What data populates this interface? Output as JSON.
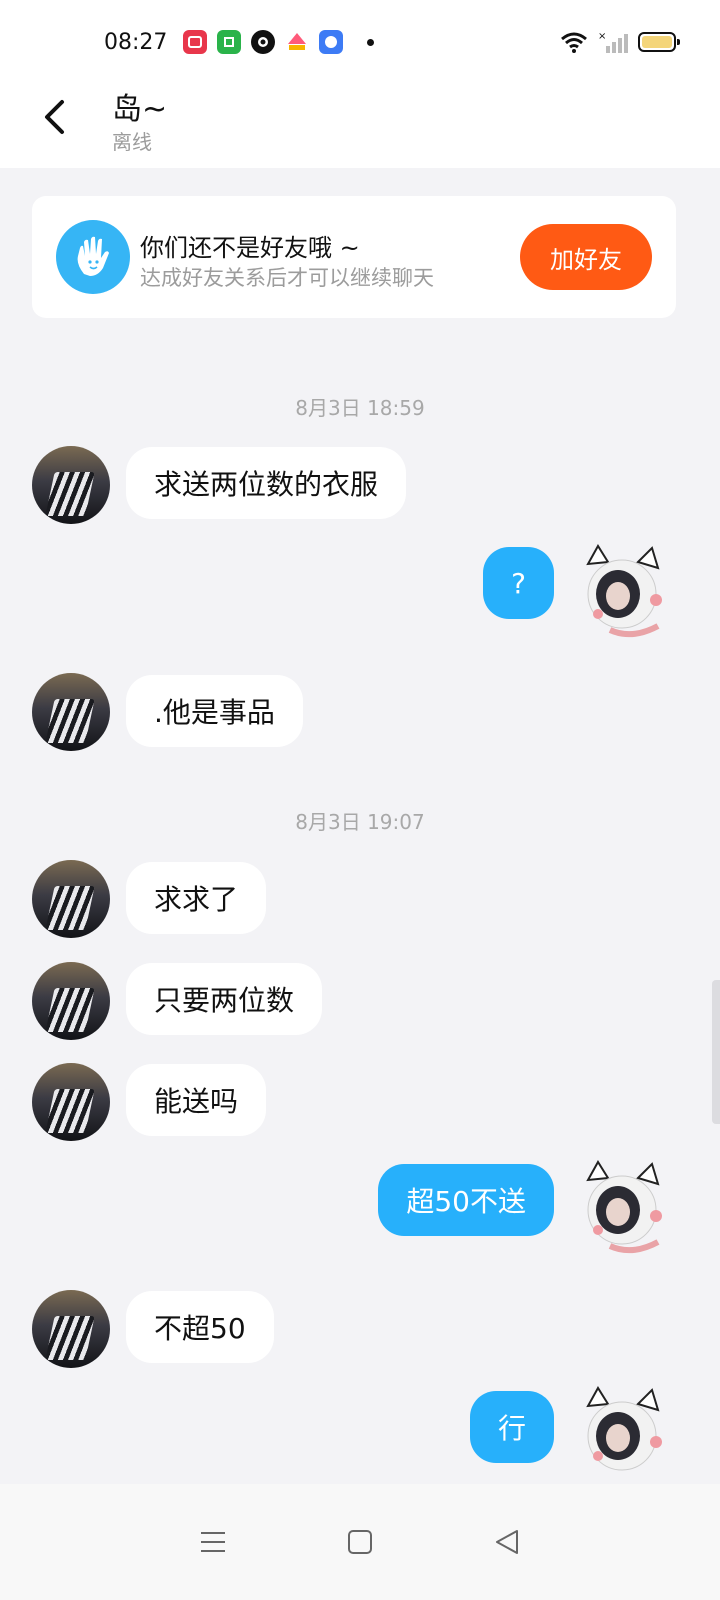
{
  "status_bar": {
    "time": "08:27",
    "app_icons": [
      {
        "name": "video-app-icon",
        "color": "#e8364b"
      },
      {
        "name": "green-app-icon",
        "color": "#2ab34a"
      },
      {
        "name": "black-app-icon",
        "color": "#111111"
      },
      {
        "name": "live-app-icon",
        "color": "#ff5a7a"
      },
      {
        "name": "blue-app-icon",
        "color": "#3d7bf5"
      }
    ]
  },
  "header": {
    "title": "岛~",
    "status": "离线"
  },
  "friend_card": {
    "title": "你们还不是好友哦 ~",
    "subtitle": "达成好友关系后才可以继续聊天",
    "button": "加好友"
  },
  "messages": {
    "ts1": "8月3日 18:59",
    "m1": "求送两位数的衣服",
    "m2": "?",
    "m3": ".他是事品",
    "ts2": "8月3日 19:07",
    "m4": "求求了",
    "m5": "只要两位数",
    "m6": "能送吗",
    "m7": "超50不送",
    "m8": "不超50",
    "m9": "行"
  },
  "colors": {
    "accent_orange": "#ff5a14",
    "bubble_blue": "#27b0fb",
    "background": "#f3f3f6"
  }
}
